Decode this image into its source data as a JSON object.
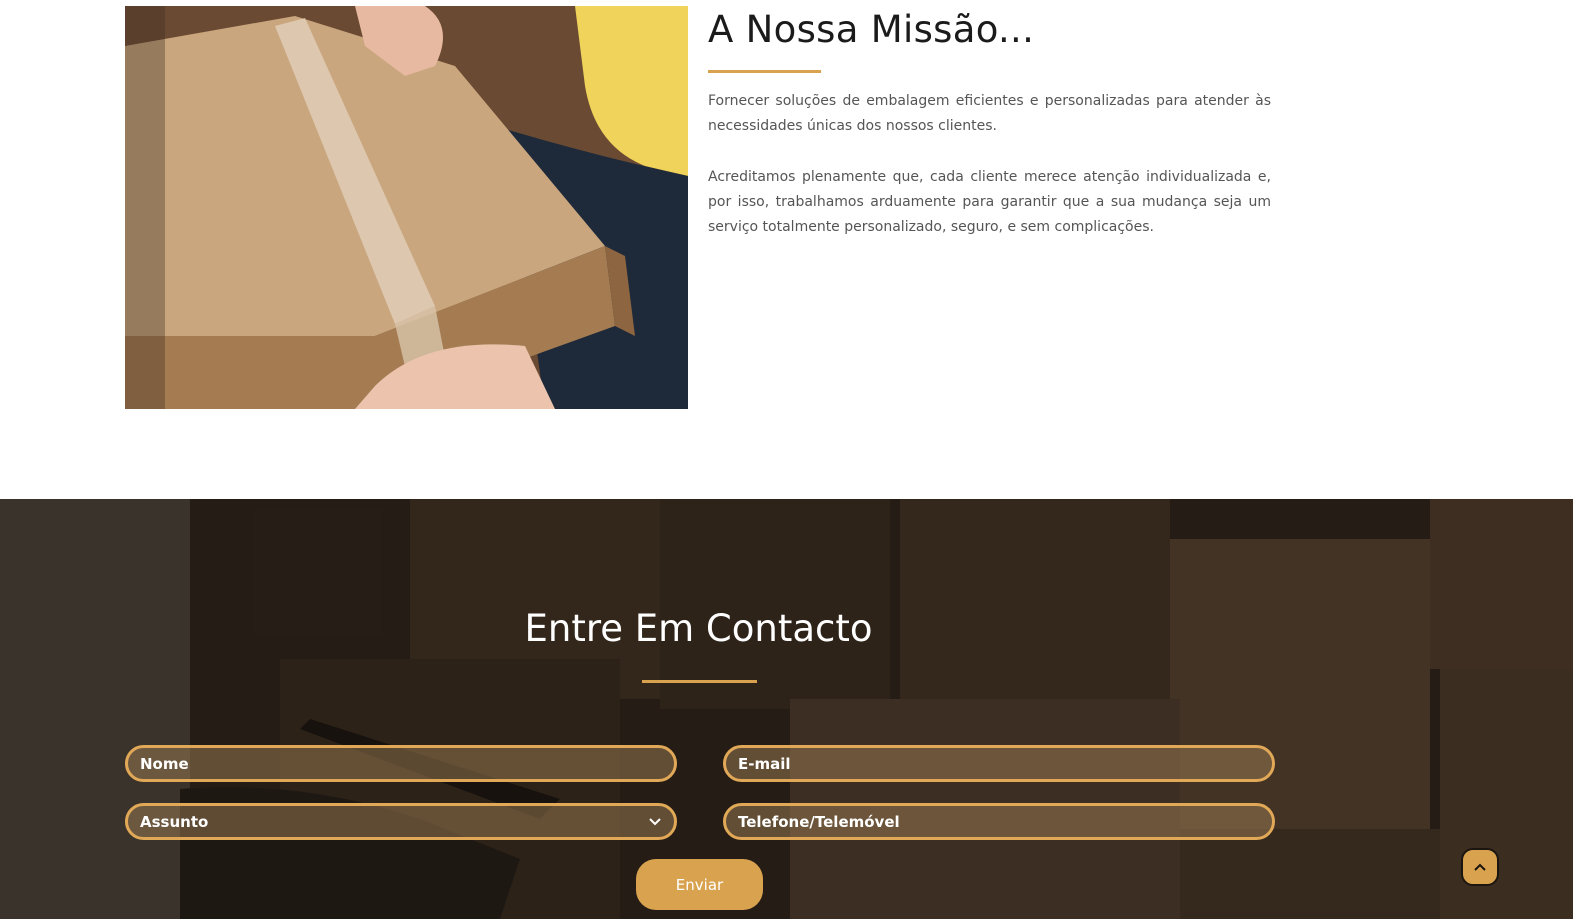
{
  "mission": {
    "title": "A Nossa Missão...",
    "paragraph_1": "Fornecer soluções de embalagem eficientes e personalizadas para atender às necessidades únicas dos nossos clientes.",
    "paragraph_2": "Acreditamos plenamente que, cada cliente merece atenção individualizada e, por isso, trabalhamos arduamente para garantir que a sua mudança seja um serviço totalmente personalizado, seguro, e sem complicações.",
    "image_icon": "cardboard-box-photo"
  },
  "contact": {
    "title": "Entre Em Contacto",
    "name_placeholder": "Nome",
    "email_placeholder": "E-mail",
    "subject_selected": "Assunto",
    "phone_placeholder": "Telefone/Telemóvel",
    "send_label": "Enviar",
    "scroll_top_icon": "chevron-up-icon"
  },
  "colors": {
    "accent": "#d9a24e",
    "contact_bg": "#2a211a",
    "title_dark": "#1b1b1b",
    "body_text": "#555555"
  }
}
